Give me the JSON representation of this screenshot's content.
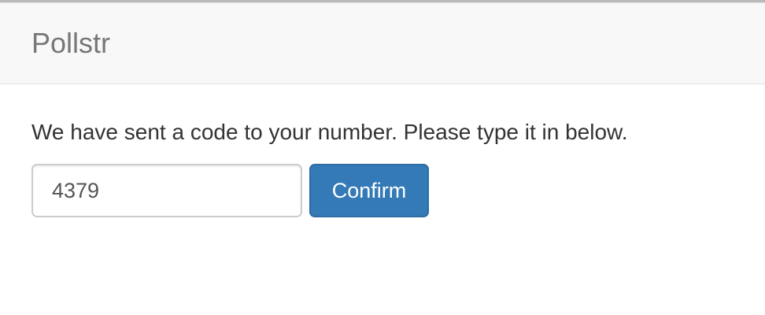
{
  "navbar": {
    "brand": "Pollstr"
  },
  "main": {
    "instructions": "We have sent a code to your number. Please type it in below.",
    "code_input": {
      "value": "4379",
      "placeholder": ""
    },
    "confirm_label": "Confirm"
  },
  "colors": {
    "navbar_background": "#f8f8f8",
    "brand_text": "#777777",
    "primary_button": "#337ab7",
    "body_text": "#333333"
  }
}
